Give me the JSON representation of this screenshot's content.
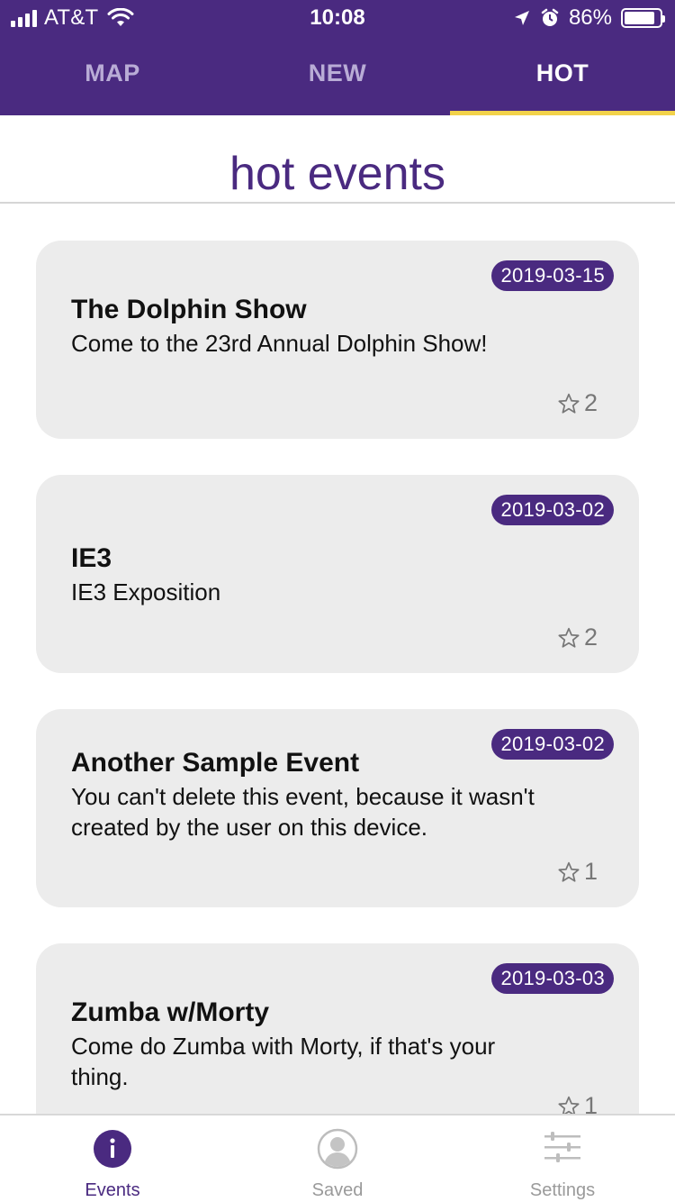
{
  "status_bar": {
    "carrier": "AT&T",
    "time": "10:08",
    "battery_percent": "86%",
    "battery_level": 0.86
  },
  "top_tabs": [
    {
      "label": "MAP",
      "active": false
    },
    {
      "label": "NEW",
      "active": false
    },
    {
      "label": "HOT",
      "active": true
    }
  ],
  "page_title": "hot events",
  "events": [
    {
      "date": "2019-03-15",
      "title": "The Dolphin Show",
      "description": "Come to the 23rd Annual Dolphin Show!",
      "stars": "2"
    },
    {
      "date": "2019-03-02",
      "title": "IE3",
      "description": "IE3 Exposition",
      "stars": "2"
    },
    {
      "date": "2019-03-02",
      "title": "Another Sample Event",
      "description": "You can't delete this event, because it wasn't created by the user on this device.",
      "stars": "1"
    },
    {
      "date": "2019-03-03",
      "title": "Zumba w/Morty",
      "description": "Come do Zumba with Morty, if that's your thing.",
      "stars": "1"
    }
  ],
  "bottom_tabs": [
    {
      "label": "Events",
      "icon": "info-icon",
      "active": true
    },
    {
      "label": "Saved",
      "icon": "user-icon",
      "active": false
    },
    {
      "label": "Settings",
      "icon": "sliders-icon",
      "active": false
    }
  ],
  "colors": {
    "brand_purple": "#4a2a80",
    "tab_indicator": "#f2d24a",
    "card_bg": "#ececec"
  }
}
